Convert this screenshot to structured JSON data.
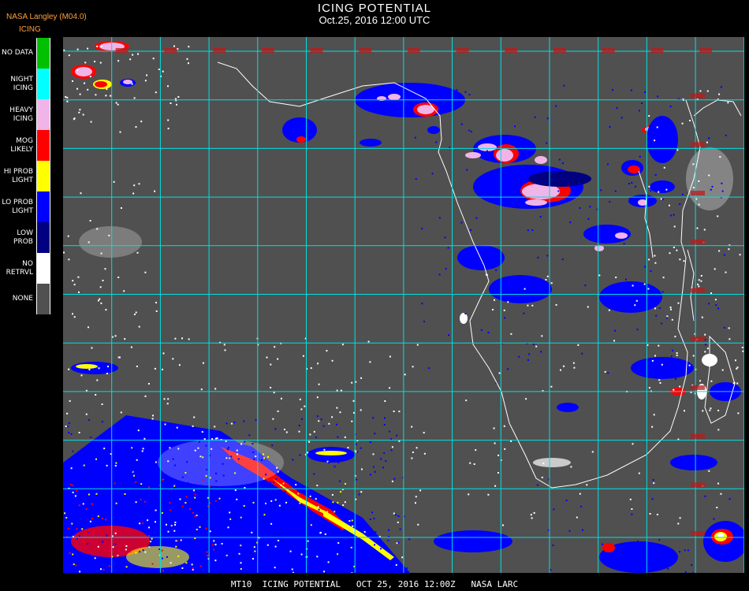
{
  "header": {
    "title": "ICING POTENTIAL",
    "subtitle": "Oct.25, 2016 12:00 UTC",
    "producer": "NASA Langley (M04.0)",
    "product": "ICING"
  },
  "legend": {
    "items": [
      {
        "line1": "NO DATA",
        "line2": "",
        "color": "#00c000"
      },
      {
        "line1": "NIGHT",
        "line2": "ICING",
        "color": "#00ffff"
      },
      {
        "line1": "HEAVY",
        "line2": "ICING",
        "color": "#f0b4e8"
      },
      {
        "line1": "MOG",
        "line2": "LIKELY",
        "color": "#ff0000"
      },
      {
        "line1": "HI PROB",
        "line2": "LIGHT",
        "color": "#ffff00"
      },
      {
        "line1": "LO PROB",
        "line2": "LIGHT",
        "color": "#0000ff"
      },
      {
        "line1": "LOW",
        "line2": "PROB",
        "color": "#000080"
      },
      {
        "line1": "NO",
        "line2": "RETRVL",
        "color": "#ffffff"
      },
      {
        "line1": "NONE",
        "line2": "",
        "color": "#505050"
      }
    ]
  },
  "map": {
    "background_color": "#505050",
    "grid_color": "#00e0e0",
    "coast_color": "#ffffff",
    "label_color": "#c01818"
  },
  "footer": {
    "text": "MT10  ICING POTENTIAL   OCT 25, 2016 12:00Z   NASA LARC"
  }
}
